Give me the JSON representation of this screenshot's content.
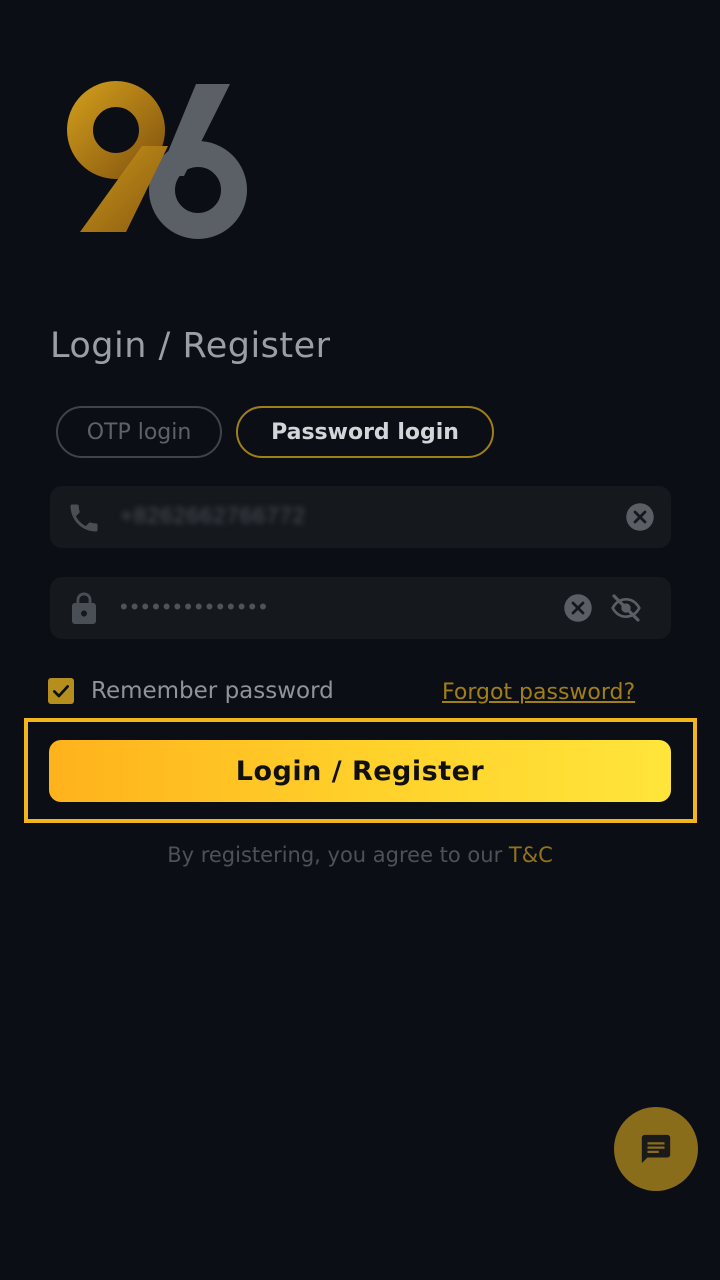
{
  "logo": {
    "text": "96",
    "colors": {
      "nine": "#b08418",
      "six": "#5b5f66"
    }
  },
  "page_title": "Login / Register",
  "tabs": [
    {
      "label": "OTP login",
      "active": false
    },
    {
      "label": "Password login",
      "active": true
    }
  ],
  "phone_field": {
    "value": "+8262662766772",
    "icon": "phone-icon",
    "clear_icon": "clear-icon"
  },
  "password_field": {
    "value": "••••••••••••••",
    "icon": "lock-icon",
    "clear_icon": "clear-icon",
    "toggle_icon": "eye-off-icon"
  },
  "remember": {
    "label": "Remember password",
    "checked": true
  },
  "forgot_link": "Forgot password?",
  "submit_button": "Login / Register",
  "terms": {
    "prefix": "By registering, you agree to our ",
    "link": "T&C"
  },
  "chat_fab": {
    "icon": "chat-icon"
  },
  "colors": {
    "background": "#0b0f15",
    "accent": "#ffc926",
    "gold_dark": "#a07e18",
    "highlight": "#f3b61a"
  }
}
